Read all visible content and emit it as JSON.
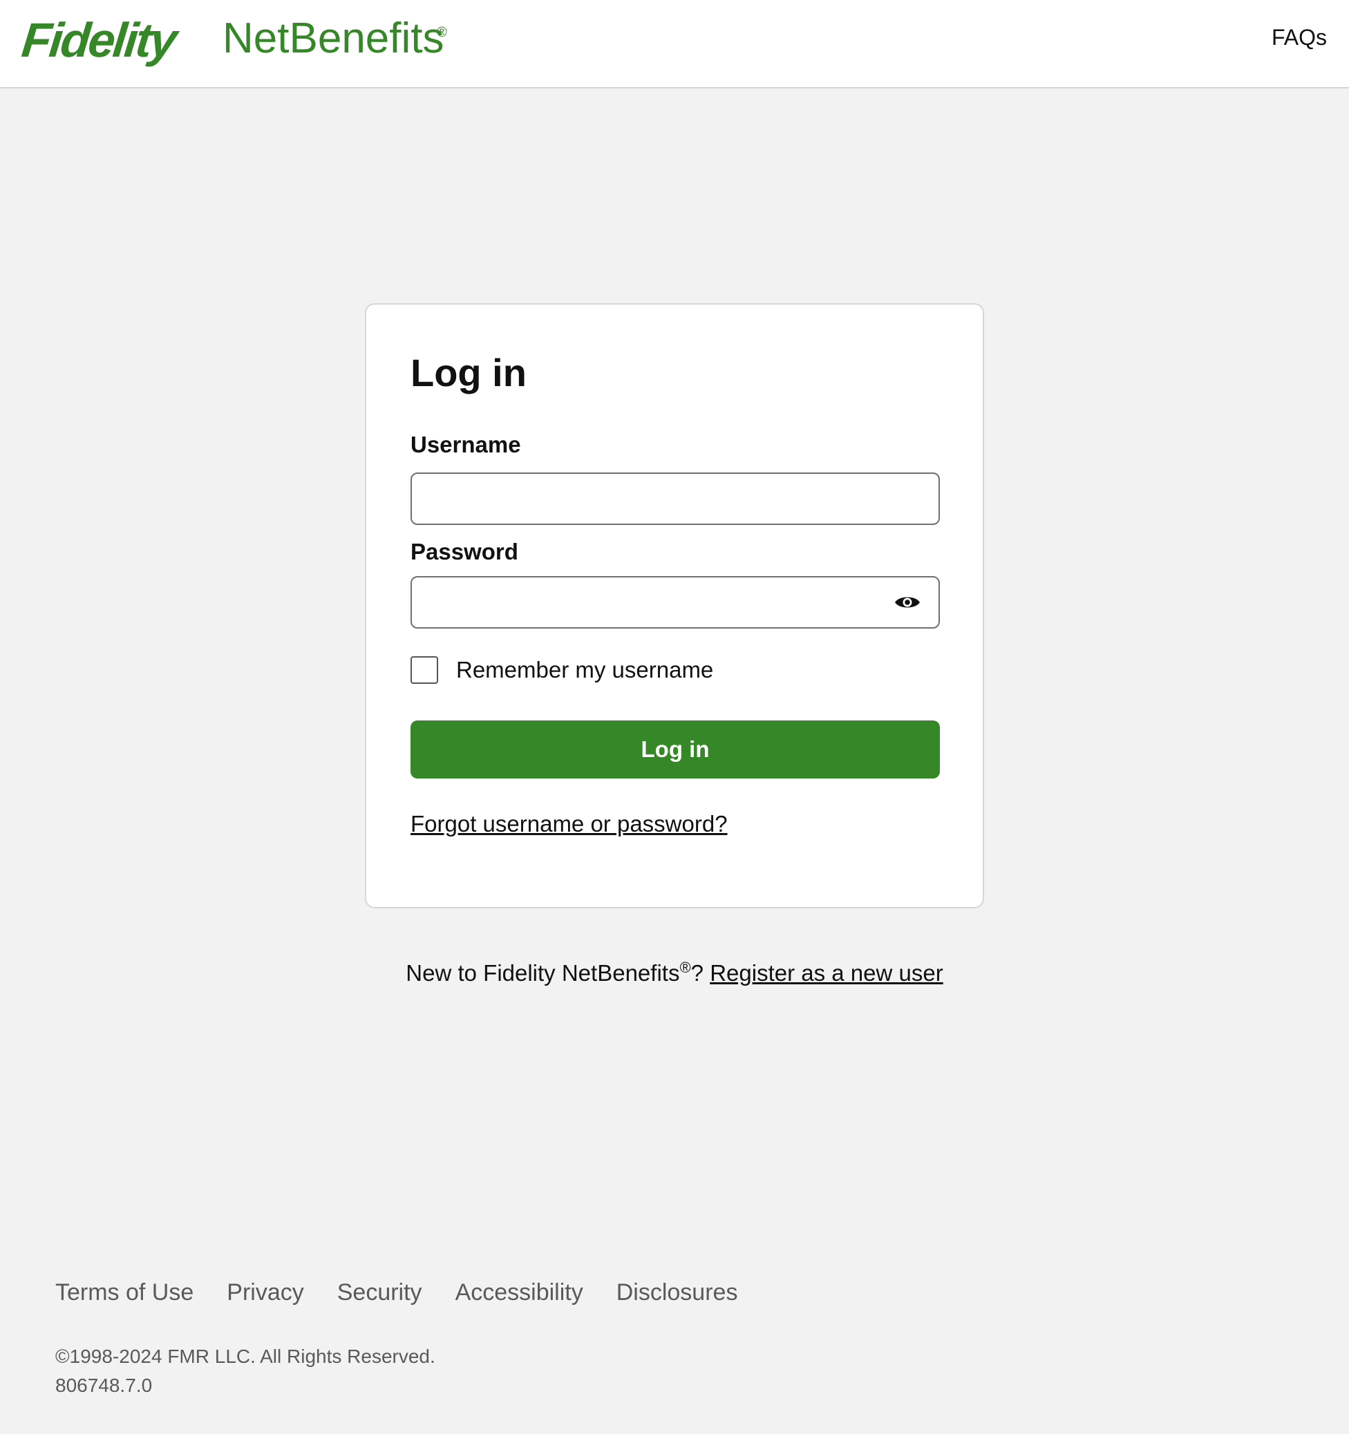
{
  "header": {
    "logo_primary": "Fidelity",
    "logo_secondary": "NetBenefits",
    "logo_mark": "®",
    "faqs_label": "FAQs"
  },
  "login_card": {
    "title": "Log in",
    "username_label": "Username",
    "username_value": "",
    "password_label": "Password",
    "password_value": "",
    "password_toggle_icon": "eye-icon",
    "remember_label": "Remember my username",
    "remember_checked": false,
    "submit_label": "Log in",
    "forgot_link": "Forgot username or password?"
  },
  "register": {
    "prefix": "New to Fidelity NetBenefits",
    "mark": "®",
    "question": "? ",
    "link": "Register as a new user"
  },
  "footer": {
    "links": [
      "Terms of Use",
      "Privacy",
      "Security",
      "Accessibility",
      "Disclosures"
    ],
    "copyright": "©1998-2024 FMR LLC. All Rights Reserved.",
    "version": "806748.7.0"
  },
  "colors": {
    "brand_green": "#368727",
    "page_background": "#f2f2f2",
    "card_background": "#ffffff"
  }
}
